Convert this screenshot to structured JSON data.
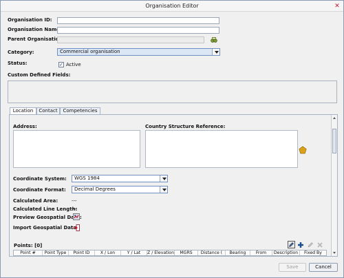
{
  "window": {
    "title": "Organisation Editor",
    "close_glyph": "✕"
  },
  "form": {
    "organisation_id_label": "Organisation ID:",
    "organisation_id_value": "",
    "organisation_name_label": "Organisation Name:",
    "organisation_name_value": "",
    "parent_organisation_label": "Parent Organisation:",
    "parent_organisation_value": "",
    "category_label": "Category:",
    "category_value": "Commercial organisation",
    "status_label": "Status:",
    "status_active_label": "Active",
    "status_active_checked": true,
    "custom_fields_label": "Custom Defined Fields:"
  },
  "tabs": [
    {
      "label": "Location",
      "active": true
    },
    {
      "label": "Contact",
      "active": false
    },
    {
      "label": "Competencies",
      "active": false
    }
  ],
  "location": {
    "address_label": "Address:",
    "country_ref_label": "Country Structure Reference:",
    "coord_system_label": "Coordinate System:",
    "coord_system_value": "WGS 1984",
    "coord_format_label": "Coordinate Format:",
    "coord_format_value": "Decimal Degrees",
    "calc_area_label": "Calculated Area:",
    "calc_area_value": "---",
    "calc_line_label": "Calculated Line Length:",
    "calc_line_value": "---",
    "preview_label": "Preview Geospatial Data:",
    "import_label": "Import Geospatial Data:",
    "points_label": "Points: [0]"
  },
  "points_table": {
    "columns": [
      "Point #",
      "Point Type",
      "Point ID",
      "X / Lon",
      "Y / Lat",
      "Z / Elevation",
      "MGRS",
      "Distance (",
      "Bearing",
      "From",
      "Description",
      "Fixed By"
    ]
  },
  "buttons": {
    "save": "Save",
    "cancel": "Cancel"
  },
  "colors": {
    "accent_select": "#dce7f6",
    "close_red": "#c0192f",
    "pentagon": "#d9a21b"
  },
  "icons": [
    "binoculars-icon",
    "pentagon-icon",
    "preview-map-icon",
    "import-icon",
    "edit-icon",
    "add-icon",
    "pencil-icon",
    "delete-icon"
  ]
}
